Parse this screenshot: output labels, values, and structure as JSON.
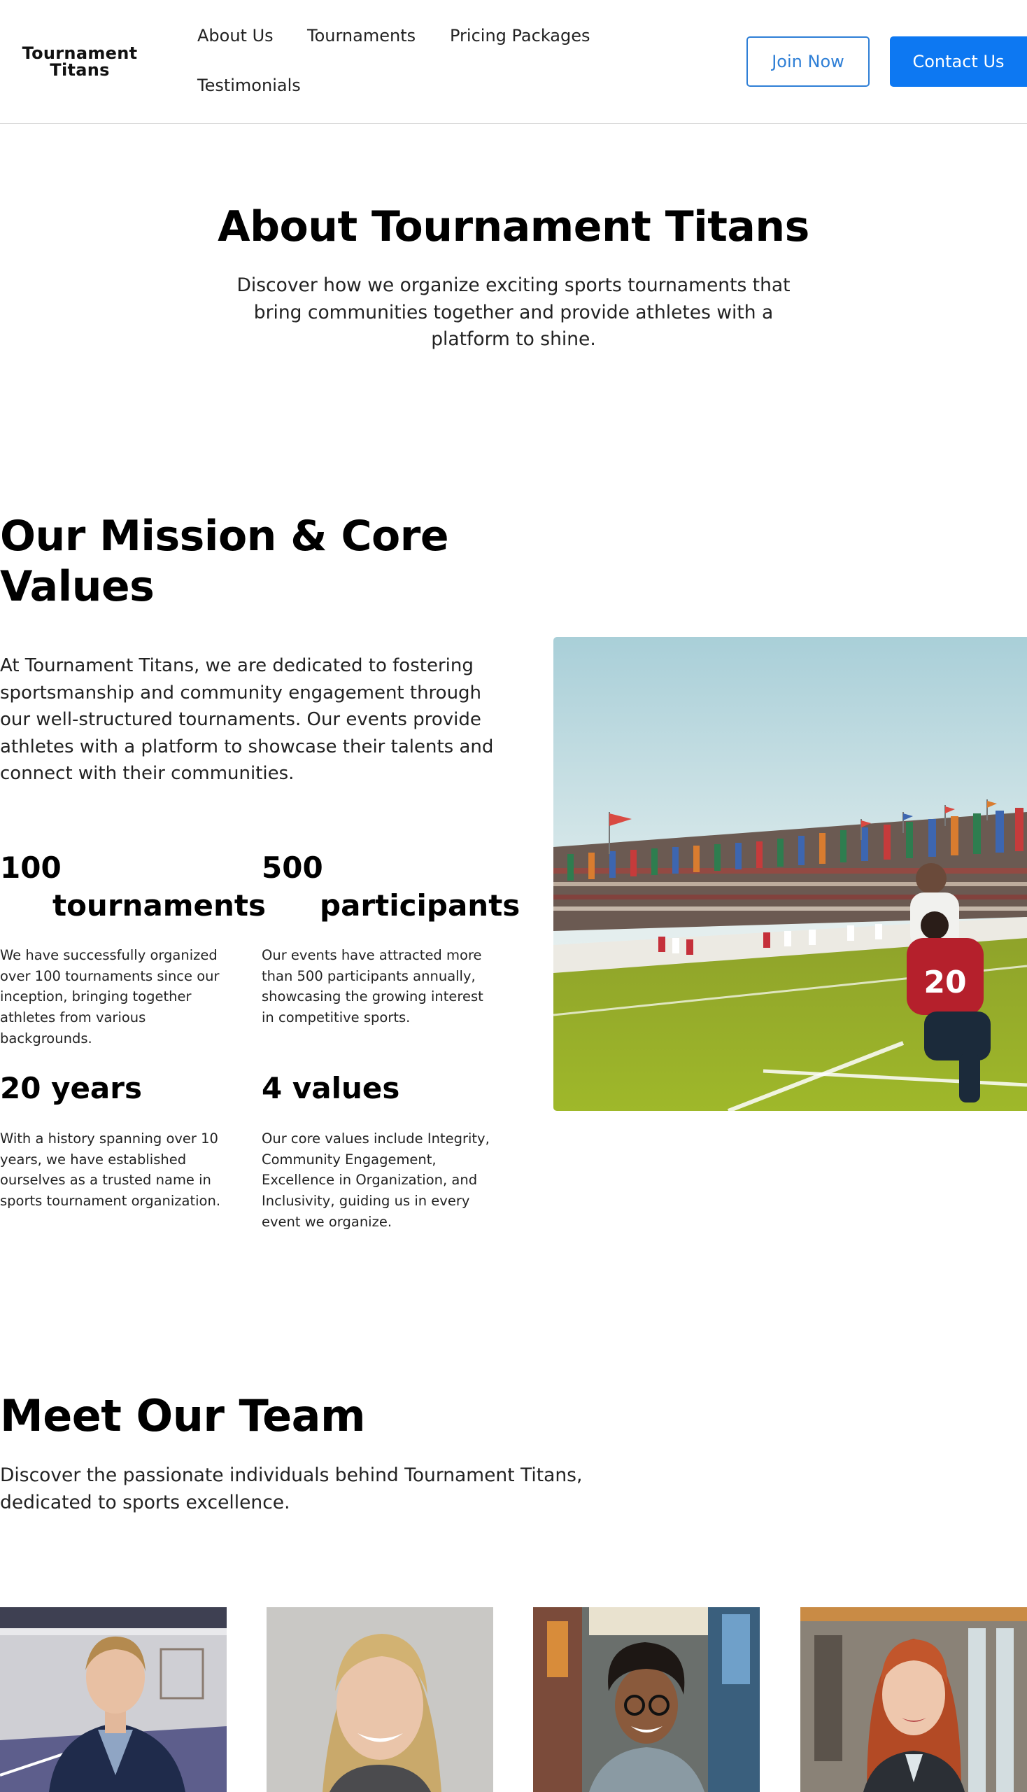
{
  "header": {
    "logo_line1": "Tournament",
    "logo_line2": "Titans",
    "nav": [
      "About Us",
      "Tournaments",
      "Pricing Packages",
      "Testimonials"
    ],
    "join_label": "Join Now",
    "contact_label": "Contact Us"
  },
  "hero": {
    "title": "About Tournament Titans",
    "subtitle": "Discover how we organize exciting sports tournaments that bring communities together and provide athletes with a platform to shine."
  },
  "mission": {
    "title": "Our Mission & Core Values",
    "text": "At Tournament Titans, we are dedicated to fostering sportsmanship and community engagement through our well-structured tournaments. Our events provide athletes with a platform to showcase their talents and connect with their communities.",
    "stats": [
      {
        "number": "100",
        "label": "tournaments",
        "desc": "We have successfully organized over 100 tournaments since our inception, bringing together athletes from various backgrounds."
      },
      {
        "number": "500",
        "label": "participants",
        "desc": "Our events have attracted more than 500 participants annually, showcasing the growing interest in competitive sports."
      },
      {
        "number": "20 years",
        "label": "",
        "desc": "With a history spanning over 10 years, we have established ourselves as a trusted name in sports tournament organization."
      },
      {
        "number": "4 values",
        "label": "",
        "desc": "Our core values include Integrity, Community Engagement, Excellence in Organization, and Inclusivity, guiding us in every event we organize."
      }
    ],
    "player_jersey": "20"
  },
  "team": {
    "title": "Meet Our Team",
    "subtitle": "Discover the passionate individuals behind Tournament Titans, dedicated to sports excellence."
  },
  "colors": {
    "primary": "#0d78f2",
    "outline": "#2f7fd6"
  }
}
